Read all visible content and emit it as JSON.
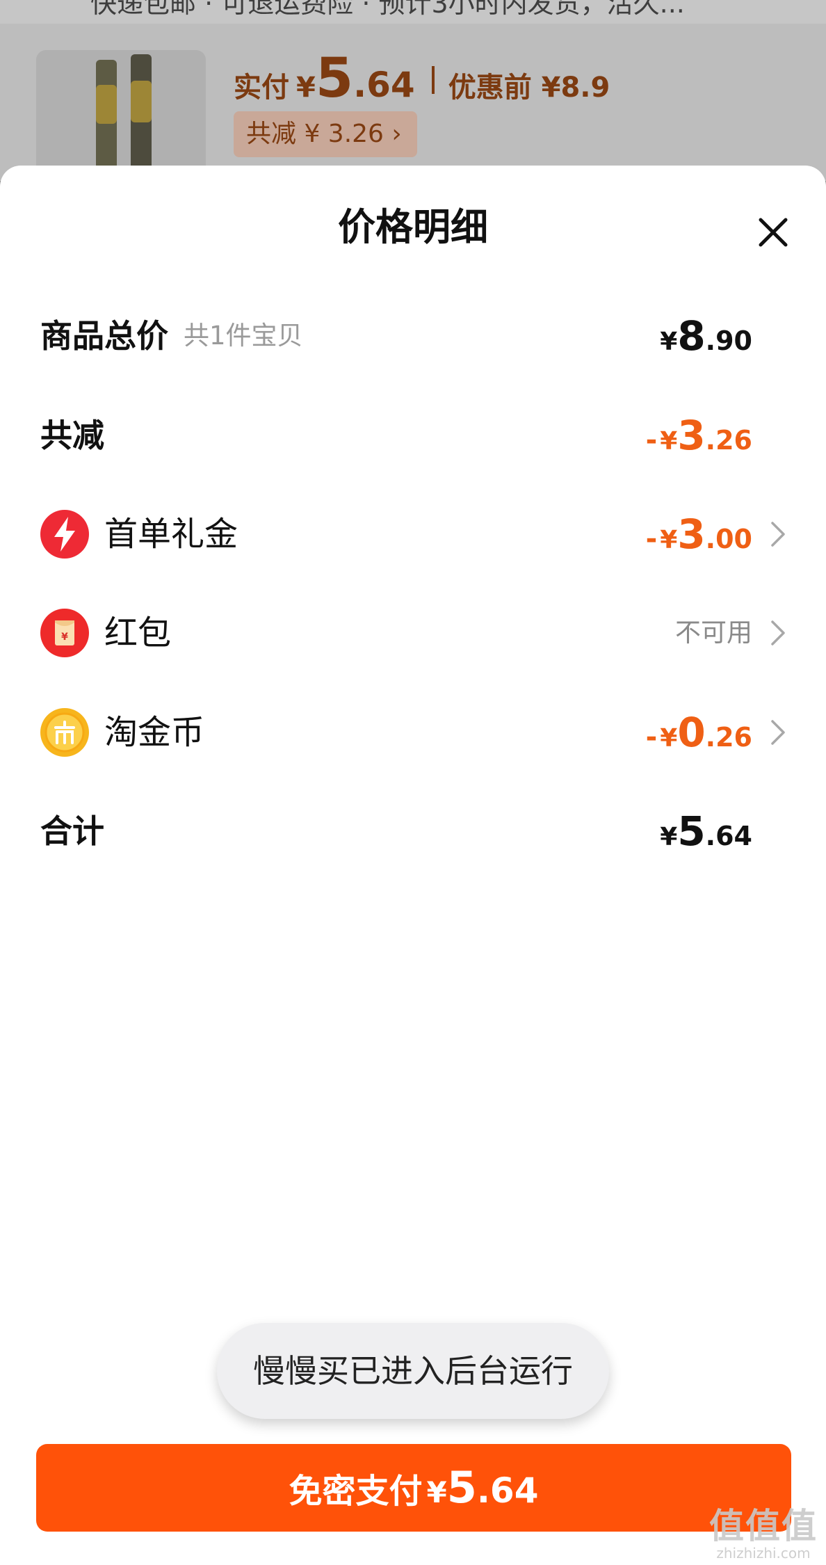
{
  "background": {
    "top_line": "快递包邮 · 可退运费险 · 预计3小时内发货，活久...",
    "pay_label": "实付",
    "pay_yen": "¥",
    "pay_int": "5",
    "pay_dec": ".64",
    "before_label": "优惠前 ¥8.9",
    "reduce_label": "共减 ¥ 3.26 ›"
  },
  "sheet": {
    "title": "价格明细",
    "rows": {
      "total": {
        "label": "商品总价",
        "sub": "共1件宝贝",
        "yen": "¥",
        "int": "8",
        "dec": ".90"
      },
      "reduce": {
        "label": "共减",
        "sign": "-",
        "yen": "¥",
        "int": "3",
        "dec": ".26"
      },
      "first_order": {
        "label": "首单礼金",
        "icon": "lightning-icon",
        "sign": "-",
        "yen": "¥",
        "int": "3",
        "dec": ".00"
      },
      "red_packet": {
        "label": "红包",
        "icon": "red-packet-icon",
        "status": "不可用"
      },
      "coins": {
        "label": "淘金币",
        "icon": "gold-coin-icon",
        "sign": "-",
        "yen": "¥",
        "int": "0",
        "dec": ".26"
      },
      "sum": {
        "label": "合计",
        "yen": "¥",
        "int": "5",
        "dec": ".64"
      }
    }
  },
  "toast": {
    "text": "慢慢买已进入后台运行"
  },
  "pay_button": {
    "label": "免密支付",
    "yen": "¥",
    "int": "5",
    "dec": ".64"
  },
  "watermark": {
    "logo_text": "值值值",
    "domain": "zhizhizhi.com"
  },
  "colors": {
    "accent_orange": "#ff5209",
    "discount_orange": "#ef5f14",
    "lightning_red": "#ee2a35",
    "coin_gold": "#f7b51c"
  }
}
